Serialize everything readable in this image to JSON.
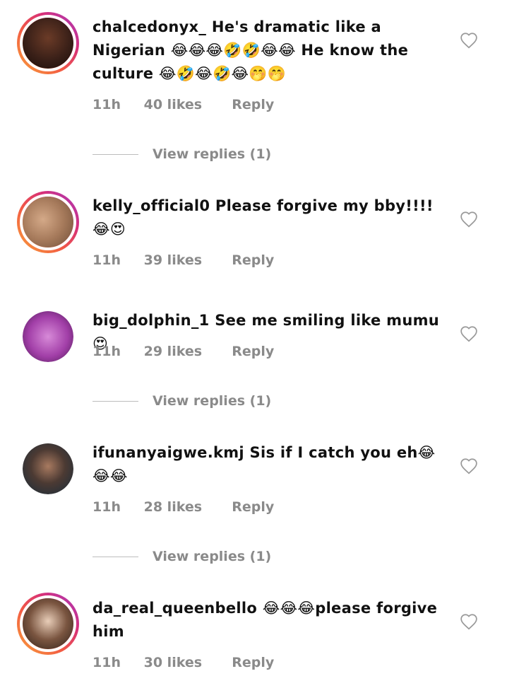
{
  "comments": [
    {
      "username": "chalcedonyx_",
      "text": "He's dramatic like a Nigerian 😂😂😂🤣🤣😂😂 He know the culture 😂🤣😂🤣😂🤭🤭",
      "time": "11h",
      "likes": "40 likes",
      "reply": "Reply",
      "view_replies": "View replies (1)",
      "avatar_color": "#3a2018",
      "story_ring": true
    },
    {
      "username": "kelly_official0",
      "text": "Please forgive my bby!!!!😂😍",
      "time": "11h",
      "likes": "39 likes",
      "reply": "Reply",
      "avatar_color": "#a67a5b",
      "story_ring": true
    },
    {
      "username": "big_dolphin_1",
      "text": "See me smiling like mumu 😍",
      "time": "11h",
      "likes": "29 likes",
      "reply": "Reply",
      "view_replies": "View replies (1)",
      "avatar_color": "#a23fa8",
      "story_ring": false
    },
    {
      "username": "ifunanyaigwe.kmj",
      "text": "Sis if I catch you eh😂😂😂",
      "time": "11h",
      "likes": "28 likes",
      "reply": "Reply",
      "view_replies": "View replies (1)",
      "avatar_color": "#25343f",
      "story_ring": false
    },
    {
      "username": "da_real_queenbello",
      "text": "😂😂😂please forgive him",
      "time": "11h",
      "likes": "30 likes",
      "reply": "Reply",
      "avatar_color": "#7a5540",
      "story_ring": true
    }
  ],
  "icons": {
    "heart": "heart-outline-icon"
  },
  "colors": {
    "meta_text": "#8a8a8a",
    "story_ring_start": "#f9a23a",
    "story_ring_end": "#a23cc4"
  }
}
